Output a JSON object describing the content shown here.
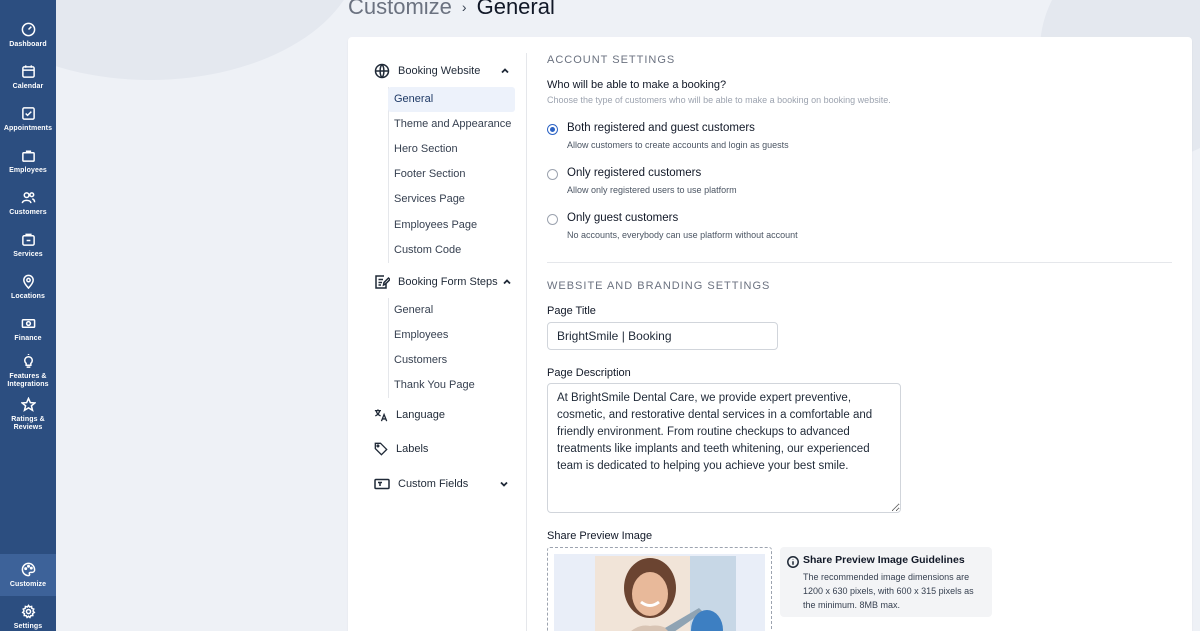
{
  "sidebar": {
    "items": [
      {
        "label": "Dashboard",
        "icon": "dashboard-icon"
      },
      {
        "label": "Calendar",
        "icon": "calendar-icon"
      },
      {
        "label": "Appointments",
        "icon": "appointments-icon"
      },
      {
        "label": "Employees",
        "icon": "employees-icon"
      },
      {
        "label": "Customers",
        "icon": "customers-icon"
      },
      {
        "label": "Services",
        "icon": "services-icon"
      },
      {
        "label": "Locations",
        "icon": "location-pin-icon"
      },
      {
        "label": "Finance",
        "icon": "finance-icon"
      },
      {
        "label": "Features &\nIntegrations",
        "icon": "lightbulb-icon"
      },
      {
        "label": "Ratings &\nReviews",
        "icon": "star-icon"
      },
      {
        "label": "Customize",
        "icon": "palette-icon"
      },
      {
        "label": "Settings",
        "icon": "gear-icon"
      }
    ],
    "active": "Customize"
  },
  "breadcrumb": {
    "parent": "Customize",
    "separator": "›",
    "current": "General"
  },
  "left_nav": {
    "booking_website": {
      "label": "Booking Website",
      "items": [
        "General",
        "Theme and Appearance",
        "Hero Section",
        "Footer Section",
        "Services Page",
        "Employees Page",
        "Custom Code"
      ],
      "active": "General"
    },
    "booking_form_steps": {
      "label": "Booking Form Steps",
      "items": [
        "General",
        "Employees",
        "Customers",
        "Thank You Page"
      ]
    },
    "language": "Language",
    "labels": "Labels",
    "custom_fields": "Custom Fields"
  },
  "account_settings": {
    "title": "ACCOUNT SETTINGS",
    "question": "Who will be able to make a booking?",
    "question_sub": "Choose the type of customers who will be able to make a booking on booking website.",
    "options": [
      {
        "title": "Both registered and guest customers",
        "desc": "Allow customers to create accounts and login as guests",
        "checked": true
      },
      {
        "title": "Only registered customers",
        "desc": "Allow only registered users to use platform",
        "checked": false
      },
      {
        "title": "Only guest customers",
        "desc": "No accounts, everybody can use platform without account",
        "checked": false
      }
    ]
  },
  "branding": {
    "title": "WEBSITE AND BRANDING SETTINGS",
    "page_title_label": "Page Title",
    "page_title_value": "BrightSmile | Booking",
    "page_description_label": "Page Description",
    "page_description_value": "At BrightSmile Dental Care, we provide expert preventive, cosmetic, and restorative dental services in a comfortable and friendly environment. From routine checkups to advanced treatments like implants and teeth whitening, our experienced team is dedicated to helping you achieve your best smile.",
    "share_image_label": "Share Preview Image",
    "guidelines_title": "Share Preview Image Guidelines",
    "guidelines_text": "The recommended image dimensions are 1200 x 630 pixels, with 600 x 315 pixels as the minimum. 8MB max."
  },
  "colors": {
    "sidebar": "#2c4e80",
    "sidebar_active": "#3d6299",
    "accent": "#2c63c4"
  }
}
